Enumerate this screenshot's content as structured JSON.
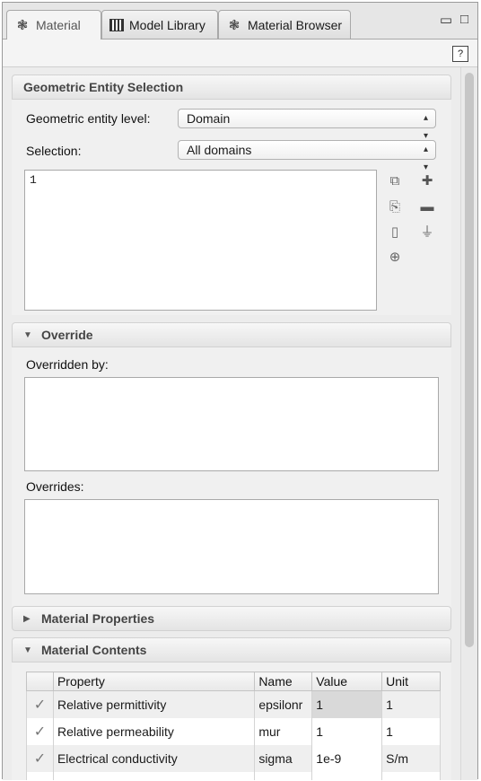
{
  "tabs": [
    {
      "label": "Material",
      "icon": "material-icon",
      "active": true
    },
    {
      "label": "Model Library",
      "icon": "library-icon",
      "active": false
    },
    {
      "label": "Material Browser",
      "icon": "material-icon",
      "active": false
    }
  ],
  "window_controls": {
    "minimize": "▭",
    "maximize": "□"
  },
  "geometric_entity_selection": {
    "title": "Geometric Entity Selection",
    "level_label": "Geometric entity level:",
    "level_value": "Domain",
    "selection_label": "Selection:",
    "selection_value": "All domains",
    "selected_items": [
      "1"
    ]
  },
  "override": {
    "title": "Override",
    "overridden_by_label": "Overridden by:",
    "overrides_label": "Overrides:"
  },
  "material_properties": {
    "title": "Material Properties"
  },
  "material_contents": {
    "title": "Material Contents",
    "columns": [
      "Property",
      "Name",
      "Value",
      "Unit"
    ],
    "rows": [
      {
        "property": "Relative permittivity",
        "name": "epsilonr",
        "value": "1",
        "unit": "1"
      },
      {
        "property": "Relative permeability",
        "name": "mur",
        "value": "1",
        "unit": "1"
      },
      {
        "property": "Electrical conductivity",
        "name": "sigma",
        "value": "1e-9",
        "unit": "S/m"
      }
    ]
  }
}
